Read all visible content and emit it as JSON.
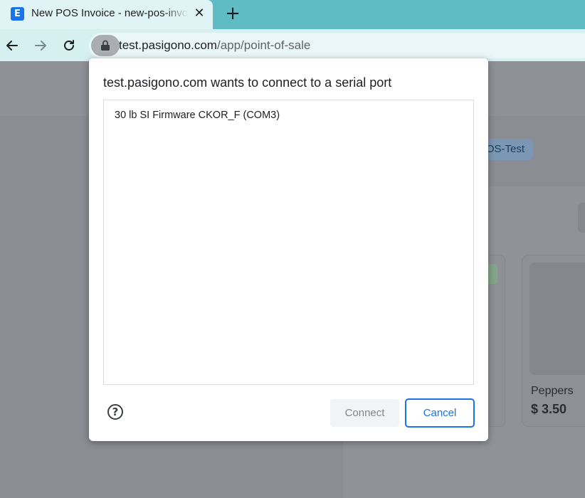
{
  "browser": {
    "tab": {
      "title": "New POS Invoice - new-pos-invoice",
      "favicon_letter": "E",
      "close_glyph": "✕"
    },
    "new_tab_glyph": "+",
    "address": {
      "host": "test.pasigono.com",
      "path": "/app/point-of-sale"
    },
    "icons": [
      "back-icon",
      "forward-icon",
      "reload-icon",
      "lock-icon"
    ]
  },
  "background_page": {
    "badge_text": "POS-Test",
    "product": {
      "name": "Peppers",
      "price": "$ 3.50"
    }
  },
  "dialog": {
    "title": "test.pasigono.com wants to connect to a serial port",
    "ports": [
      "30 lb SI Firmware CKOR_F (COM3)"
    ],
    "help_glyph": "?",
    "connect_label": "Connect",
    "cancel_label": "Cancel"
  },
  "colors": {
    "tabstrip": "#5fbcc4",
    "toolbar": "#d6eff1",
    "accent": "#1a73e8",
    "scrim": "#8a8d92"
  }
}
